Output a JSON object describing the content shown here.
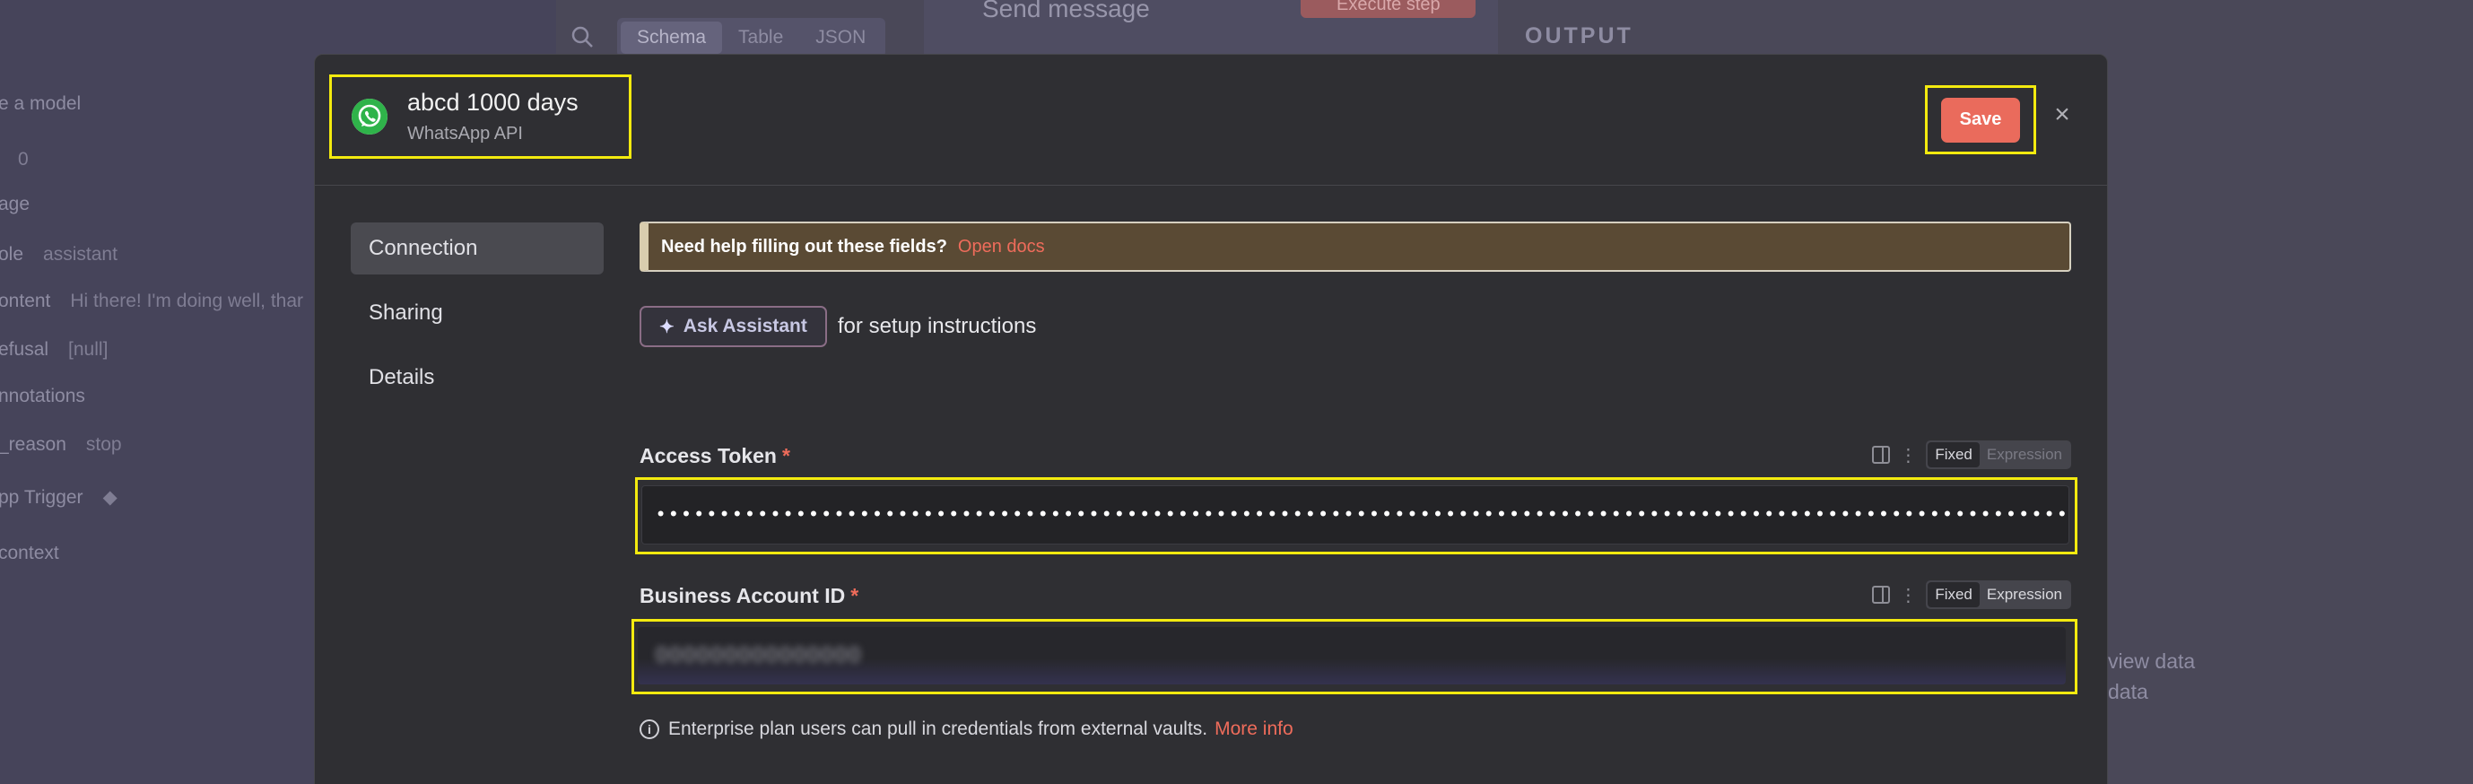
{
  "background": {
    "left_panel": [
      {
        "label": "e a model",
        "value": ""
      },
      {
        "label": "",
        "value": "0"
      },
      {
        "label": "age",
        "value": ""
      },
      {
        "label": "ole",
        "value": "assistant"
      },
      {
        "label": "ontent",
        "value": "Hi there! I'm doing well, thar"
      },
      {
        "label": "efusal",
        "value": "[null]"
      },
      {
        "label": "nnotations",
        "value": ""
      },
      {
        "label": "_reason",
        "value": "stop"
      },
      {
        "label": "pp Trigger",
        "value": "◆"
      },
      {
        "label": "context",
        "value": ""
      }
    ],
    "tabs": [
      "Schema",
      "Table",
      "JSON"
    ],
    "node_title": "Send message",
    "execute_label": "Execute step",
    "output_label": "OUTPUT",
    "view_text": "view data",
    "data_text": "data"
  },
  "modal": {
    "credential_name": "abcd 1000 days",
    "credential_type": "WhatsApp API",
    "save_label": "Save",
    "close_glyph": "×",
    "nav": [
      {
        "label": "Connection",
        "active": true
      },
      {
        "label": "Sharing",
        "active": false
      },
      {
        "label": "Details",
        "active": false
      }
    ],
    "notice_text": "Need help filling out these fields?",
    "notice_link": "Open docs",
    "assistant_label": "Ask Assistant",
    "assistant_suffix": "for setup instructions",
    "access_token": {
      "label": "Access Token",
      "required": "*",
      "mode_fixed": "Fixed",
      "mode_expression": "Expression",
      "masked_value": "••••••••••••••••••••••••••••••••••••••••••••••••••••••••••••••••••••••••••••••••••••••••••••••••••••••••••••••••••••••••••••••••••"
    },
    "business_account_id": {
      "label": "Business Account ID",
      "required": "*",
      "mode_fixed": "Fixed",
      "mode_expression": "Expression",
      "value": "000000000000000"
    },
    "enterprise_text": "Enterprise plan users can pull in credentials from external vaults.",
    "enterprise_link": "More info"
  },
  "colors": {
    "accent": "#ea6b5c",
    "highlight": "#f3ea0f",
    "modal_bg": "#2f2f33"
  },
  "icons": {
    "credential_icon": "whatsapp-icon",
    "search": "search-icon",
    "assistant": "sparkle-icon",
    "info": "info-icon"
  }
}
